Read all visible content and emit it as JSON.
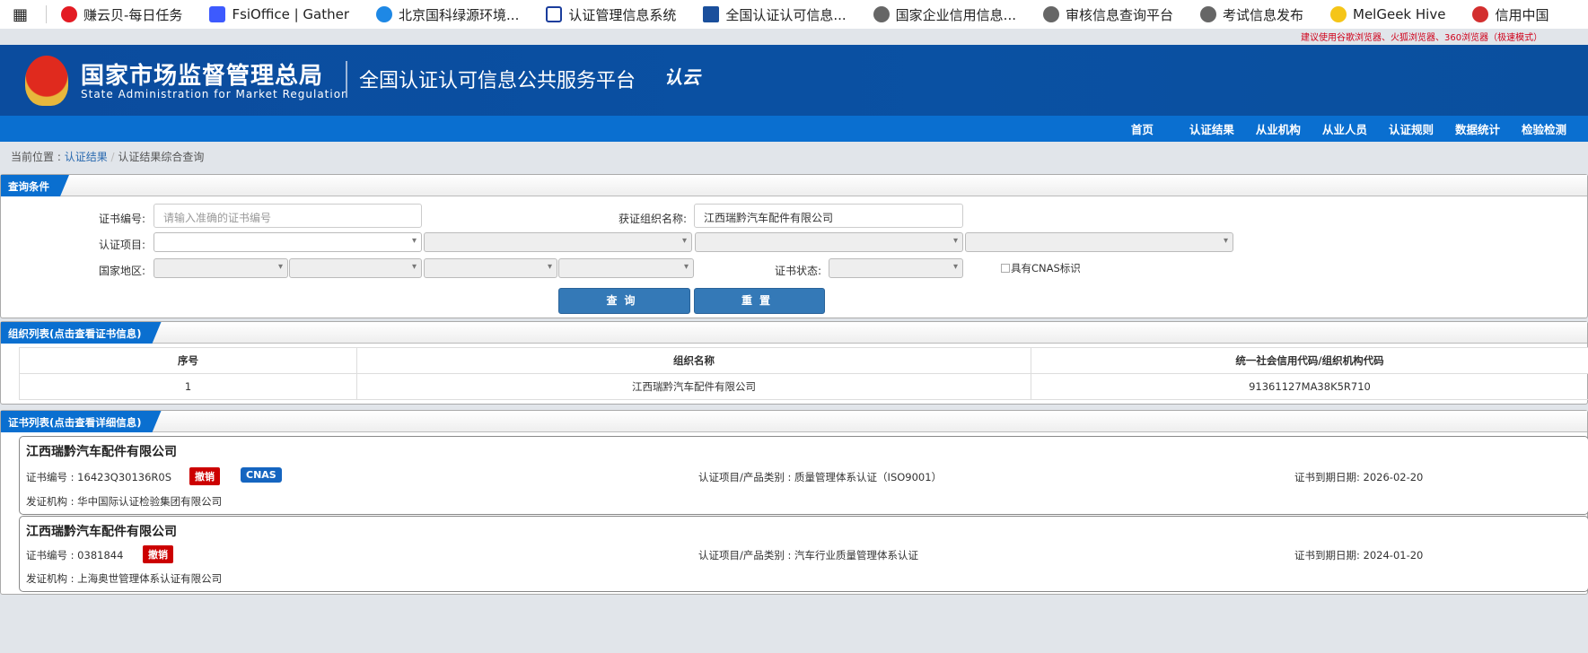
{
  "bookmarks": [
    "赚云贝-每日任务",
    "FsiOffice | Gather",
    "北京国科绿源环境...",
    "认证管理信息系统",
    "全国认证认可信息...",
    "国家企业信用信息...",
    "审核信息查询平台",
    "考试信息发布",
    "MelGeek Hive",
    "信用中国"
  ],
  "notice": "建议使用谷歌浏览器、火狐浏览器、360浏览器（极速模式）",
  "header": {
    "title": "国家市场监督管理总局",
    "title_en": "State Administration  for  Market Regulation",
    "platform": "全国认证认可信息公共服务平台",
    "logo": "认云"
  },
  "nav": [
    "首页",
    "认证结果",
    "从业机构",
    "从业人员",
    "认证规则",
    "数据统计",
    "检验检测"
  ],
  "breadcrumb": {
    "prefix": "当前位置 : ",
    "link": "认证结果",
    "sep": " / ",
    "current": "认证结果综合查询"
  },
  "query": {
    "title": "查询条件",
    "cert_no_label": "证书编号:",
    "cert_no_placeholder": "请输入准确的证书编号",
    "org_label": "获证组织名称:",
    "org_value": "江西瑞黔汽车配件有限公司",
    "item_label": "认证项目:",
    "region_label": "国家地区:",
    "status_label": "证书状态:",
    "cnas_label": "具有CNAS标识",
    "search": "查询",
    "reset": "重置"
  },
  "orgs": {
    "title": "组织列表(点击查看证书信息)",
    "columns": [
      "序号",
      "组织名称",
      "统一社会信用代码/组织机构代码"
    ],
    "rows": [
      [
        "1",
        "江西瑞黔汽车配件有限公司",
        "91361127MA38K5R710"
      ]
    ]
  },
  "certs": {
    "title": "证书列表(点击查看详细信息)",
    "items": [
      {
        "company": "江西瑞黔汽车配件有限公司",
        "cert_no": "证书编号 : 16423Q30136R0S",
        "status": "撤销",
        "cnas": "CNAS",
        "item": "认证项目/产品类别 : 质量管理体系认证（ISO9001）",
        "expiry": "证书到期日期: 2026-02-20",
        "issuer": "发证机构 : 华中国际认证检验集团有限公司"
      },
      {
        "company": "江西瑞黔汽车配件有限公司",
        "cert_no": "证书编号 : 0381844",
        "status": "撤销",
        "item": "认证项目/产品类别 : 汽车行业质量管理体系认证",
        "expiry": "证书到期日期: 2024-01-20",
        "issuer": "发证机构 : 上海奥世管理体系认证有限公司"
      }
    ]
  },
  "colors": {
    "banner": "#0b4c9e",
    "nav": "#0a6fd0",
    "revoked": "#cc0000",
    "cnas": "#1565c0"
  }
}
